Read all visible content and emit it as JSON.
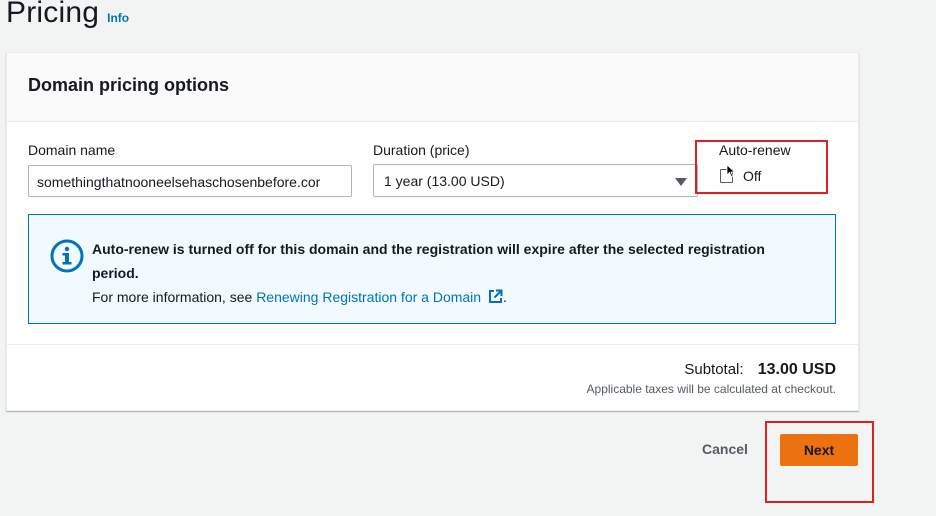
{
  "page": {
    "title": "Pricing",
    "info_link": "Info"
  },
  "panel": {
    "title": "Domain pricing options"
  },
  "form": {
    "domain_name_label": "Domain name",
    "domain_name_value": "somethingthatnooneelsehaschosenbefore.cor",
    "duration_label": "Duration (price)",
    "duration_value": "1 year (13.00 USD)",
    "auto_renew_label": "Auto-renew",
    "auto_renew_value": "Off",
    "auto_renew_checked": false
  },
  "alert": {
    "bold_text": "Auto-renew is turned off for this domain and the registration will expire after the selected registration period.",
    "info_prefix": "For more information, see",
    "link_text": "Renewing Registration for a Domain",
    "suffix": "."
  },
  "summary": {
    "subtotal_label": "Subtotal:",
    "subtotal_value": "13.00 USD",
    "tax_note": "Applicable taxes will be calculated at checkout."
  },
  "actions": {
    "cancel_label": "Cancel",
    "next_label": "Next"
  },
  "colors": {
    "primary": "#ec7211",
    "link": "#0073bb",
    "alert_bg": "#f1faff",
    "highlight": "#e02020"
  }
}
